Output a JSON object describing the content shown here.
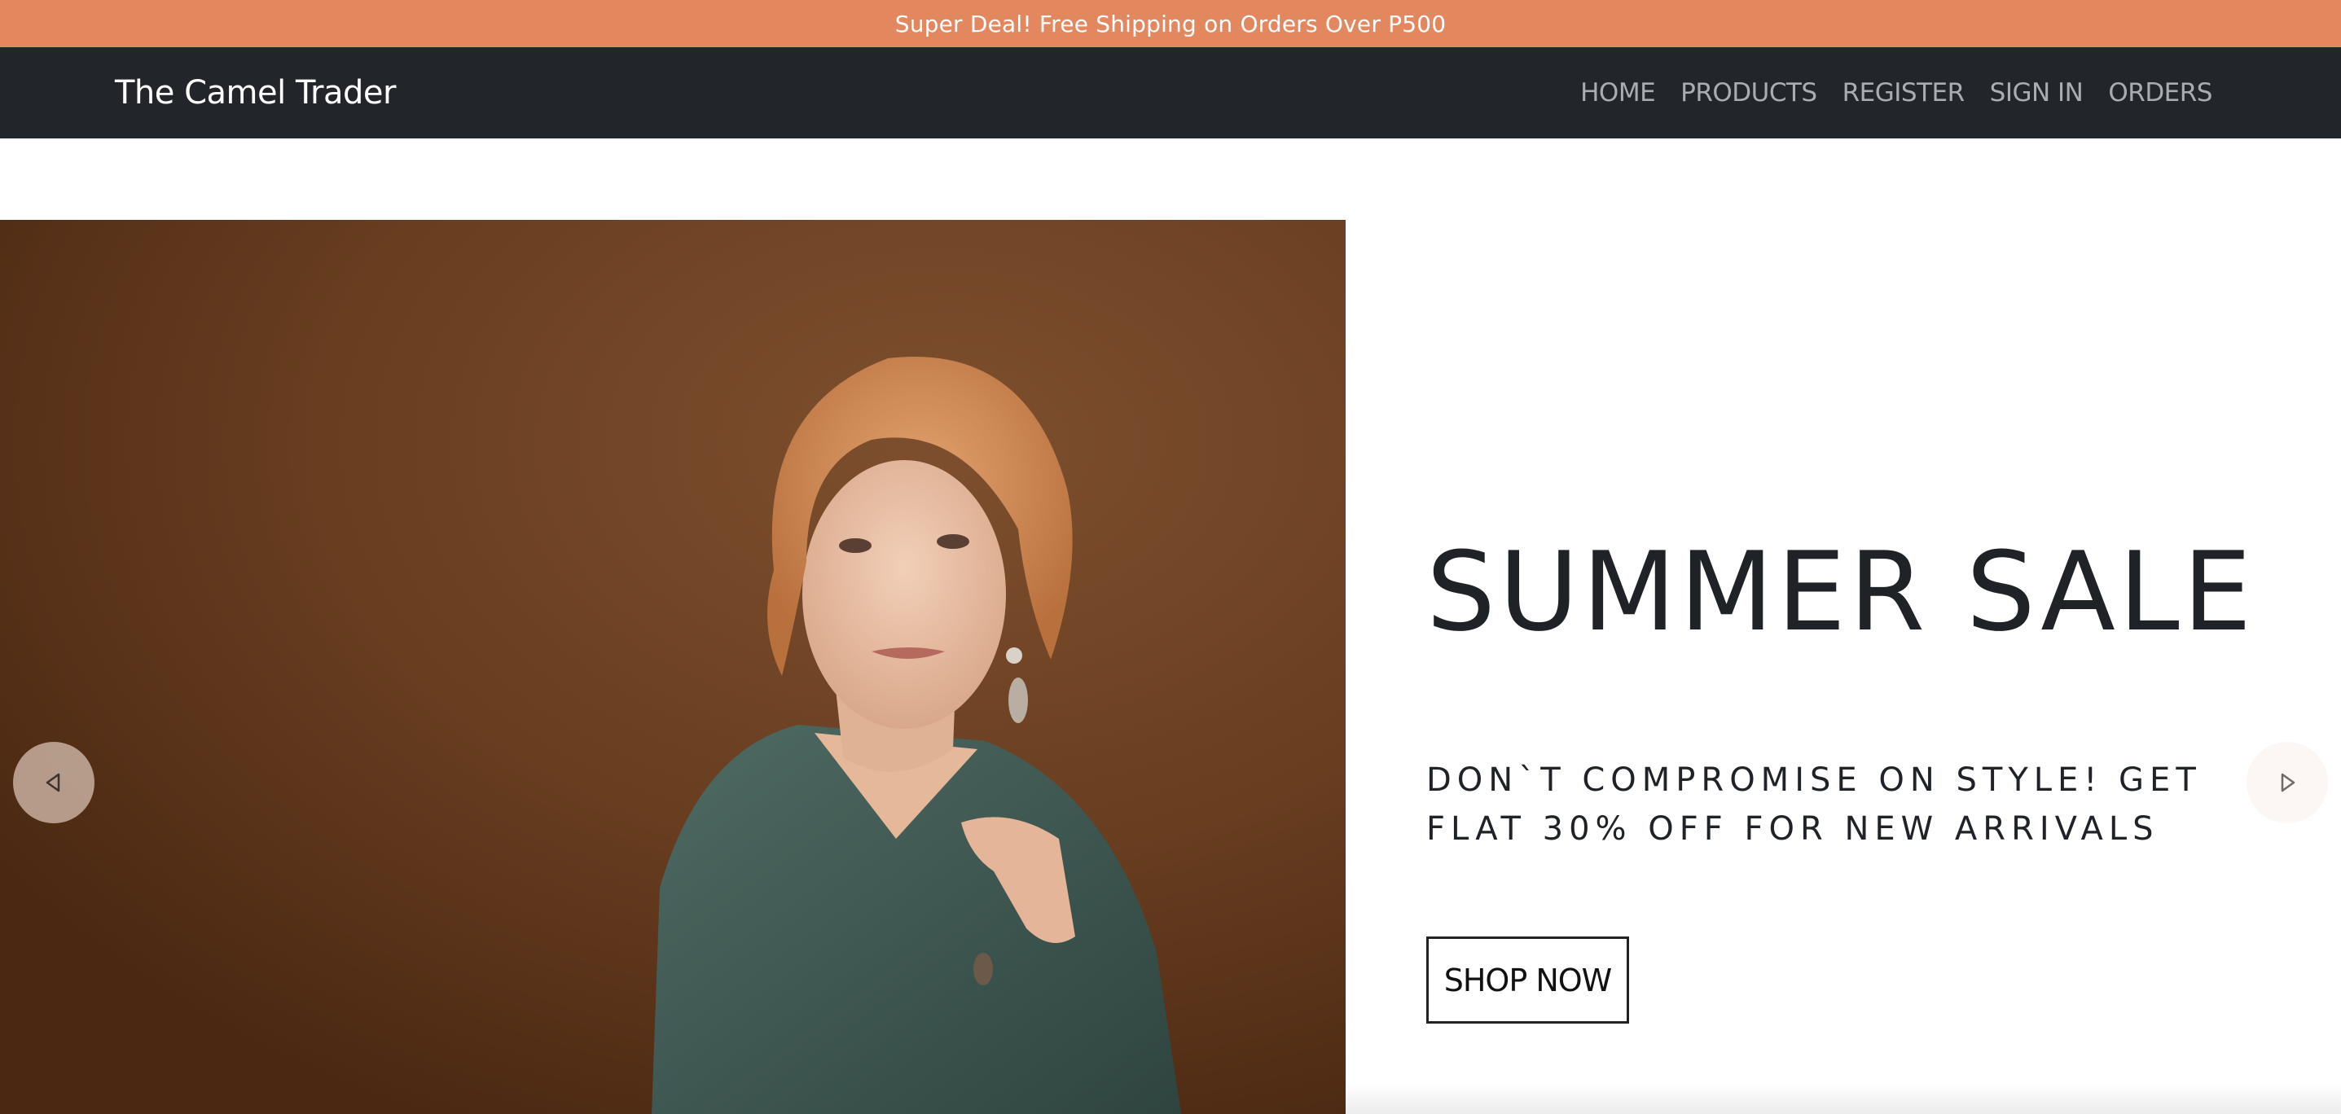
{
  "announcement": {
    "text": "Super Deal! Free Shipping on Orders Over P500",
    "background_color": "#e3875f"
  },
  "navbar": {
    "brand": "The Camel Trader",
    "background_color": "#22262b",
    "links": [
      {
        "label": "HOME"
      },
      {
        "label": "PRODUCTS"
      },
      {
        "label": "REGISTER"
      },
      {
        "label": "SIGN IN"
      },
      {
        "label": "ORDERS"
      }
    ]
  },
  "hero": {
    "image_icon": "model-photo",
    "title": "SUMMER SALE",
    "subtitle": "DON`T COMPROMISE ON STYLE! GET FLAT 30% OFF FOR NEW ARRIVALS",
    "cta_label": "SHOP NOW",
    "prev_icon": "triangle-left-icon",
    "next_icon": "triangle-right-icon"
  }
}
